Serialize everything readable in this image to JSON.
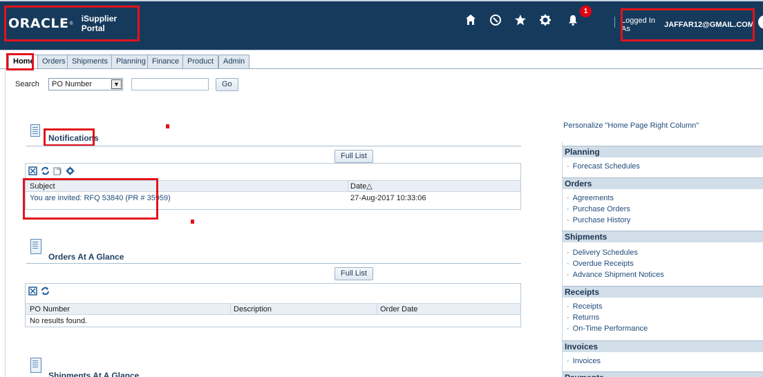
{
  "header": {
    "brand": "ORACLE",
    "brand_mark": "®",
    "portal_name": "iSupplier Portal",
    "notification_count": "1",
    "login_label": "Logged In As",
    "login_user": "JAFFAR12@GMAIL.COM",
    "icons": [
      "home-icon",
      "compass-icon",
      "favorites-star-icon",
      "settings-gear-icon",
      "notifications-bell-icon"
    ]
  },
  "tabs": [
    {
      "label": "Home",
      "active": true
    },
    {
      "label": "Orders"
    },
    {
      "label": "Shipments"
    },
    {
      "label": "Planning"
    },
    {
      "label": "Finance"
    },
    {
      "label": "Product"
    },
    {
      "label": "Admin"
    }
  ],
  "search": {
    "label": "Search",
    "selected": "PO Number",
    "value": "",
    "go_label": "Go"
  },
  "notifications": {
    "title": "Notifications",
    "full_list": "Full List",
    "columns": [
      "Subject",
      "Date"
    ],
    "sort_indicator": "△",
    "rows": [
      {
        "subject": "You are invited: RFQ 53840 (PR # 35959)",
        "date": "27-Aug-2017 10:33:06"
      }
    ]
  },
  "orders": {
    "title": "Orders At A Glance",
    "full_list": "Full List",
    "columns": [
      "PO Number",
      "Description",
      "Order Date"
    ],
    "empty": "No results found."
  },
  "shipments": {
    "title": "Shipments At A Glance"
  },
  "right_column": {
    "personalize": "Personalize \"Home Page Right Column\"",
    "sections": [
      {
        "title": "Planning",
        "items": [
          "Forecast Schedules"
        ]
      },
      {
        "title": "Orders",
        "items": [
          "Agreements",
          "Purchase Orders",
          "Purchase History"
        ]
      },
      {
        "title": "Shipments",
        "items": [
          "Delivery Schedules",
          "Overdue Receipts",
          "Advance Shipment Notices"
        ]
      },
      {
        "title": "Receipts",
        "items": [
          "Receipts",
          "Returns",
          "On-Time Performance"
        ]
      },
      {
        "title": "Invoices",
        "items": [
          "Invoices"
        ]
      },
      {
        "title": "Payments",
        "items": []
      }
    ]
  },
  "colors": {
    "header_bg": "#163a5c",
    "annotation_red": "#e3131b",
    "link": "#1f4b7a",
    "badge": "#e60012"
  }
}
